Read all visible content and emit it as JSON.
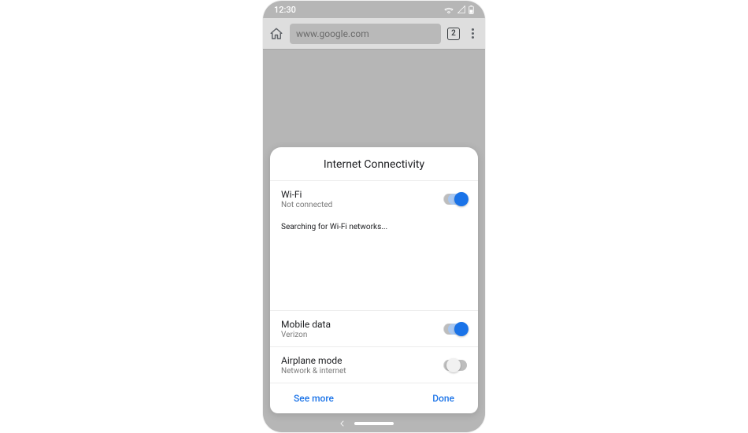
{
  "statusbar": {
    "time": "12:30"
  },
  "browser": {
    "url": "www.google.com",
    "tab_count": "2"
  },
  "sheet": {
    "title": "Internet Connectivity",
    "wifi": {
      "title": "Wi-Fi",
      "subtitle": "Not connected",
      "on": true
    },
    "searching_text": "Searching for Wi-Fi networks...",
    "mobile_data": {
      "title": "Mobile data",
      "subtitle": "Verizon",
      "on": true
    },
    "airplane": {
      "title": "Airplane mode",
      "subtitle": "Network & internet",
      "on": false
    },
    "see_more": "See more",
    "done": "Done"
  }
}
